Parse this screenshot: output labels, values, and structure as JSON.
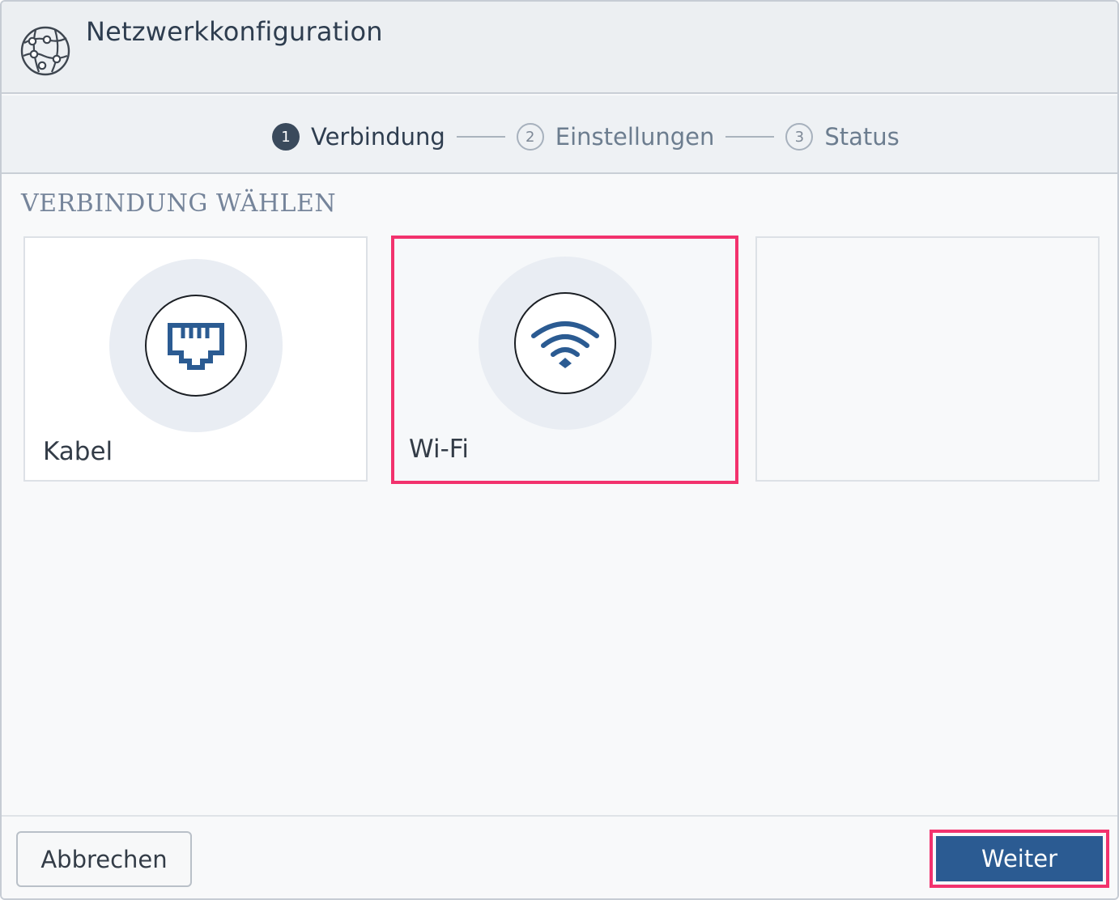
{
  "window": {
    "title": "Netzwerkkonfiguration",
    "icon": "network-globe-icon"
  },
  "stepper": {
    "steps": [
      {
        "number": "1",
        "label": "Verbindung",
        "state": "active"
      },
      {
        "number": "2",
        "label": "Einstellungen",
        "state": "inactive"
      },
      {
        "number": "3",
        "label": "Status",
        "state": "inactive"
      }
    ]
  },
  "section": {
    "title": "VERBINDUNG WÄHLEN"
  },
  "options": [
    {
      "label": "Kabel",
      "icon": "ethernet-port-icon",
      "selected": false
    },
    {
      "label": "Wi-Fi",
      "icon": "wifi-icon",
      "selected": true
    },
    {
      "label": "",
      "icon": "",
      "selected": false
    }
  ],
  "footer": {
    "cancel_label": "Abbrechen",
    "next_label": "Weiter"
  },
  "colors": {
    "accent": "#2b5b92",
    "highlight": "#f2326d",
    "icon_blue": "#2b5b92"
  }
}
